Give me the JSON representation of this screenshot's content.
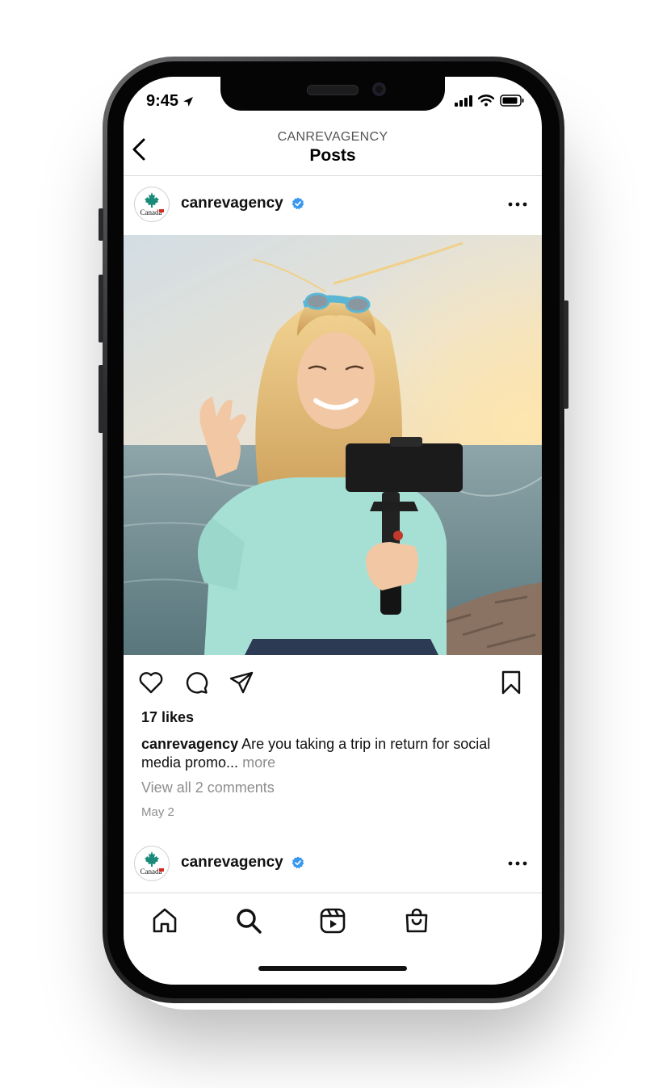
{
  "status_bar": {
    "time": "9:45",
    "icons": [
      "location-arrow-icon",
      "signal-bars-icon",
      "wifi-icon",
      "battery-icon"
    ]
  },
  "header": {
    "account": "CANREVAGENCY",
    "title": "Posts",
    "back_icon": "chevron-left-icon"
  },
  "posts": [
    {
      "username": "canrevagency",
      "verified": true,
      "avatar_text": "Canada",
      "likes": "17 likes",
      "caption_user": "canrevagency",
      "caption_text": "Are you taking a trip in return for social media promo...",
      "caption_more": "more",
      "comments_link": "View all 2 comments",
      "date": "May 2"
    },
    {
      "username": "canrevagency",
      "verified": true,
      "avatar_text": "Canada"
    }
  ],
  "actions": [
    "heart-icon",
    "comment-icon",
    "share-icon",
    "bookmark-icon"
  ],
  "tabbar": [
    "home-icon",
    "search-icon",
    "reels-icon",
    "shop-icon"
  ],
  "colors": {
    "verified_blue": "#3897f0",
    "canada_teal": "#1a8a7a",
    "canada_red": "#d52b1e"
  }
}
